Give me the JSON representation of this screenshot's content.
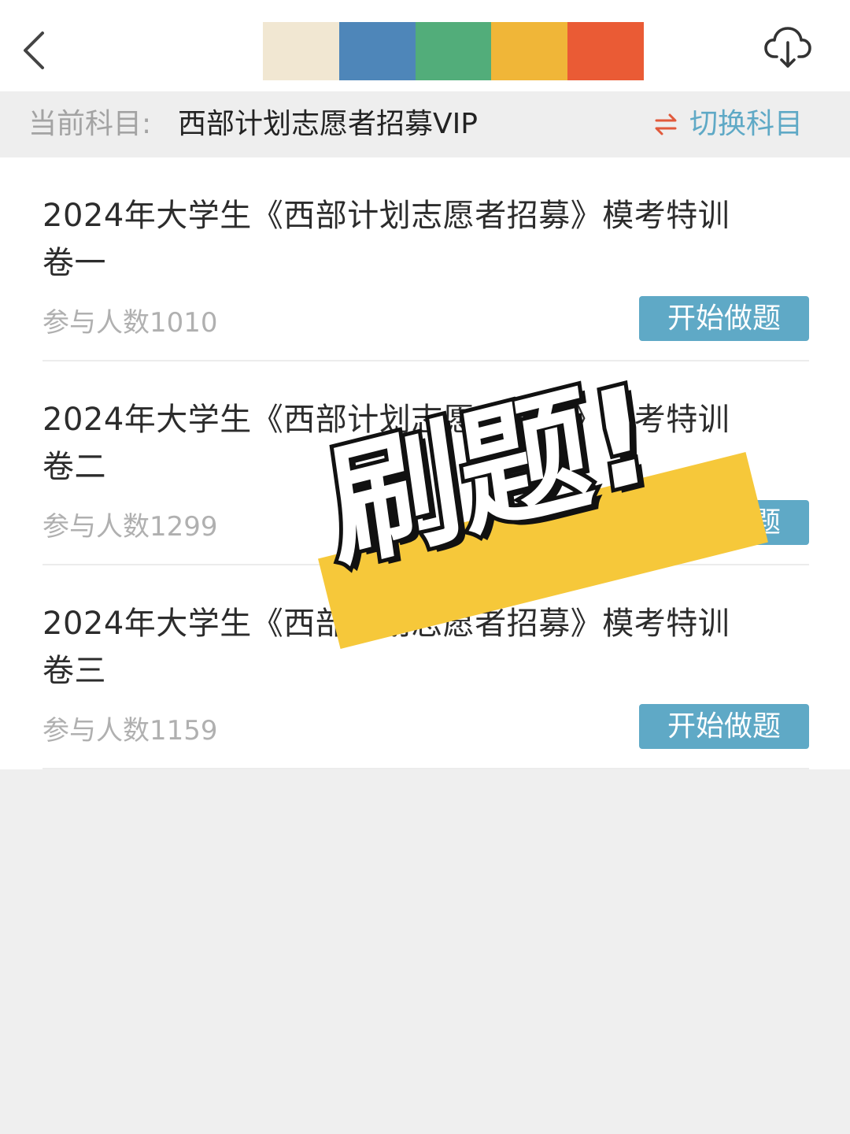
{
  "header": {
    "back_icon": "chevron-left-icon",
    "download_icon": "cloud-download-icon",
    "color_strip": [
      "#f1e7d2",
      "#4e86b9",
      "#52ad7a",
      "#f0b638",
      "#ea5b35"
    ]
  },
  "subject_bar": {
    "label": "当前科目:",
    "subject": "西部计划志愿者招募VIP",
    "switch_icon": "swap-arrows-icon",
    "switch_label": "切换科目"
  },
  "items": [
    {
      "title": "2024年大学生《西部计划志愿者招募》模考特训卷一",
      "count": "参与人数1010",
      "button": "开始做题"
    },
    {
      "title": "2024年大学生《西部计划志愿者招募》模考特训卷二",
      "count": "参与人数1299",
      "button": "开始做题"
    },
    {
      "title": "2024年大学生《西部计划志愿者招募》模考特训卷三",
      "count": "参与人数1159",
      "button": "开始做题"
    }
  ],
  "colors": {
    "accent": "#5fa9c6",
    "switch_arrow": "#e15a3c",
    "sticker_band": "#f6c83a"
  },
  "sticker": {
    "text": "刷题!"
  }
}
